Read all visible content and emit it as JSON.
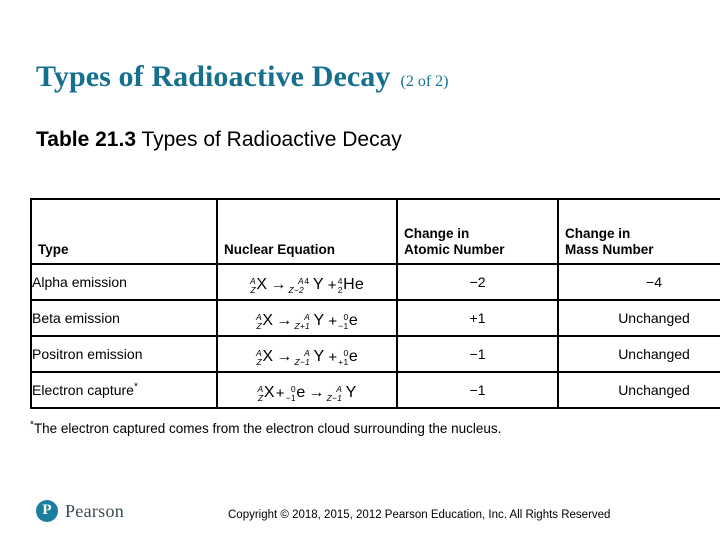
{
  "slide": {
    "title": "Types of Radioactive Decay",
    "title_suffix": "(2 of 2)",
    "accent_color": "#15708e",
    "subtitle_bold": "Table 21.3",
    "subtitle_rest": " Types of Radioactive Decay",
    "footnote_marker": "*",
    "footnote_text": "The electron captured comes from the electron cloud surrounding the nucleus."
  },
  "table": {
    "headers": {
      "type": "Type",
      "equation": "Nuclear Equation",
      "atomic_line1": "Change in",
      "atomic_line2": "Atomic Number",
      "mass_line1": "Change in",
      "mass_line2": "Mass Number"
    },
    "rows": [
      {
        "type": "Alpha emission",
        "type_star": "",
        "equation_text": "A/Z X → A-4/Z-2 Y + 4/2 He",
        "eq": {
          "r1_sup": "A",
          "r1_sub": "Z",
          "r1_sym": "X",
          "p1_sup": "A",
          "p1_sup2": "4",
          "p1_sub": "Z−2",
          "p1_sym": "Y",
          "p2_sup": "4",
          "p2_sub": "2",
          "p2_sym": "He"
        },
        "atomic": "−2",
        "mass": "−4"
      },
      {
        "type": "Beta emission",
        "type_star": "",
        "equation_text": "A/Z X → A/Z+1 Y + 0/-1 e",
        "eq": {
          "r1_sup": "A",
          "r1_sub": "Z",
          "r1_sym": "X",
          "p1_sup": "A",
          "p1_sub": "Z+1",
          "p1_sym": "Y",
          "p2_sup": "0",
          "p2_sub": "−1",
          "p2_sym": "e"
        },
        "atomic": "+1",
        "mass": "Unchanged"
      },
      {
        "type": "Positron emission",
        "type_star": "",
        "equation_text": "A/Z X → A/Z-1 Y + 0/+1 e",
        "eq": {
          "r1_sup": "A",
          "r1_sub": "Z",
          "r1_sym": "X",
          "p1_sup": "A",
          "p1_sub": "Z−1",
          "p1_sym": "Y",
          "p2_sup": "0",
          "p2_sub": "+1",
          "p2_sym": "e"
        },
        "atomic": "−1",
        "mass": "Unchanged"
      },
      {
        "type": "Electron capture",
        "type_star": "*",
        "equation_text": "A/Z X + 0/-1 e → A/Z-1 Y",
        "eq": {
          "r1_sup": "A",
          "r1_sub": "Z",
          "r1_sym": "X",
          "r2_sup": "0",
          "r2_sub": "−1",
          "r2_sym": "e",
          "p1_sup": "A",
          "p1_sub": "Z−1",
          "p1_sym": "Y"
        },
        "atomic": "−1",
        "mass": "Unchanged"
      }
    ]
  },
  "footer": {
    "logo_mark": "pearson-logo-icon",
    "logo_letter": "P",
    "logo_text": "Pearson",
    "copyright": "Copyright © 2018, 2015, 2012 Pearson Education, Inc. All Rights Reserved"
  },
  "symbols": {
    "arrow": "→",
    "plus": "+"
  }
}
